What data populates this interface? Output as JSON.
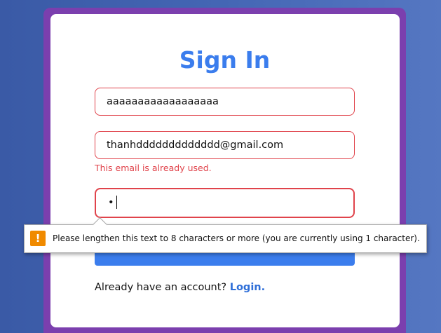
{
  "form": {
    "title": "Sign In",
    "name_value": "aaaaaaaaaaaaaaaaaa",
    "email_value": "thanhddddddddddddd@gmail.com",
    "email_error": "This email is already used.",
    "password_mask": "•",
    "footer_text": "Already have an account?",
    "login_link": "Login."
  },
  "validation_tooltip": {
    "icon": "warning-icon",
    "message": "Please lengthen this text to 8 characters or more (you are currently using 1 character)."
  },
  "colors": {
    "accent": "#3b7ded",
    "error": "#e0434b",
    "frame": "#7b3fae",
    "warning": "#f08a00"
  }
}
